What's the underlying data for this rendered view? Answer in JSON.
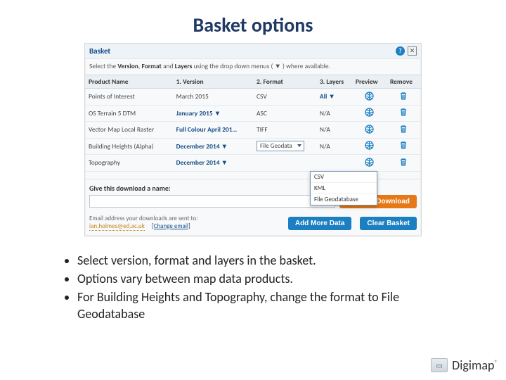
{
  "title": "Basket options",
  "basket": {
    "panel_title": "Basket",
    "instruction_pre": "Select the ",
    "instruction_b1": "Version",
    "instruction_mid1": ", ",
    "instruction_b2": "Format",
    "instruction_mid2": " and ",
    "instruction_b3": "Layers",
    "instruction_post": " using the drop down menus ( ▼ ) where available.",
    "headers": {
      "product": "Product Name",
      "version": "1. Version",
      "format": "2. Format",
      "layers": "3. Layers",
      "preview": "Preview",
      "remove": "Remove"
    },
    "rows": [
      {
        "product": "Points of Interest",
        "version": "March 2015",
        "version_link": false,
        "format": "CSV",
        "layers": "All ▼",
        "layers_link": true
      },
      {
        "product": "OS Terrain 5 DTM",
        "version": "January 2015 ▼",
        "version_link": true,
        "format": "ASC",
        "layers": "N/A"
      },
      {
        "product": "Vector Map Local Raster",
        "version": "Full Colour April 201…",
        "version_link": true,
        "format": "TIFF",
        "layers": "N/A"
      },
      {
        "product": "Building Heights (Alpha)",
        "version": "December 2014 ▼",
        "version_link": true,
        "format_select": "File Geodata",
        "layers": "N/A"
      },
      {
        "product": "Topography",
        "version": "December 2014 ▼",
        "version_link": true,
        "format": "",
        "layers": ""
      }
    ],
    "dropdown_options": [
      "CSV",
      "KML",
      "File Geodatabase"
    ],
    "name_label": "Give this download a name:",
    "request_btn": "Request Download",
    "email_label": "Email address your downloads are sent to:",
    "email": "ian.holmes@ed.ac.uk",
    "change_email": "[Change email]",
    "add_more_btn": "Add More Data",
    "clear_btn": "Clear Basket"
  },
  "bullets": [
    "Select version, format and layers in the basket.",
    "Options vary between map data products.",
    "For Building Heights and Topography, change the format to File Geodatabase"
  ],
  "brand": "Digimap"
}
